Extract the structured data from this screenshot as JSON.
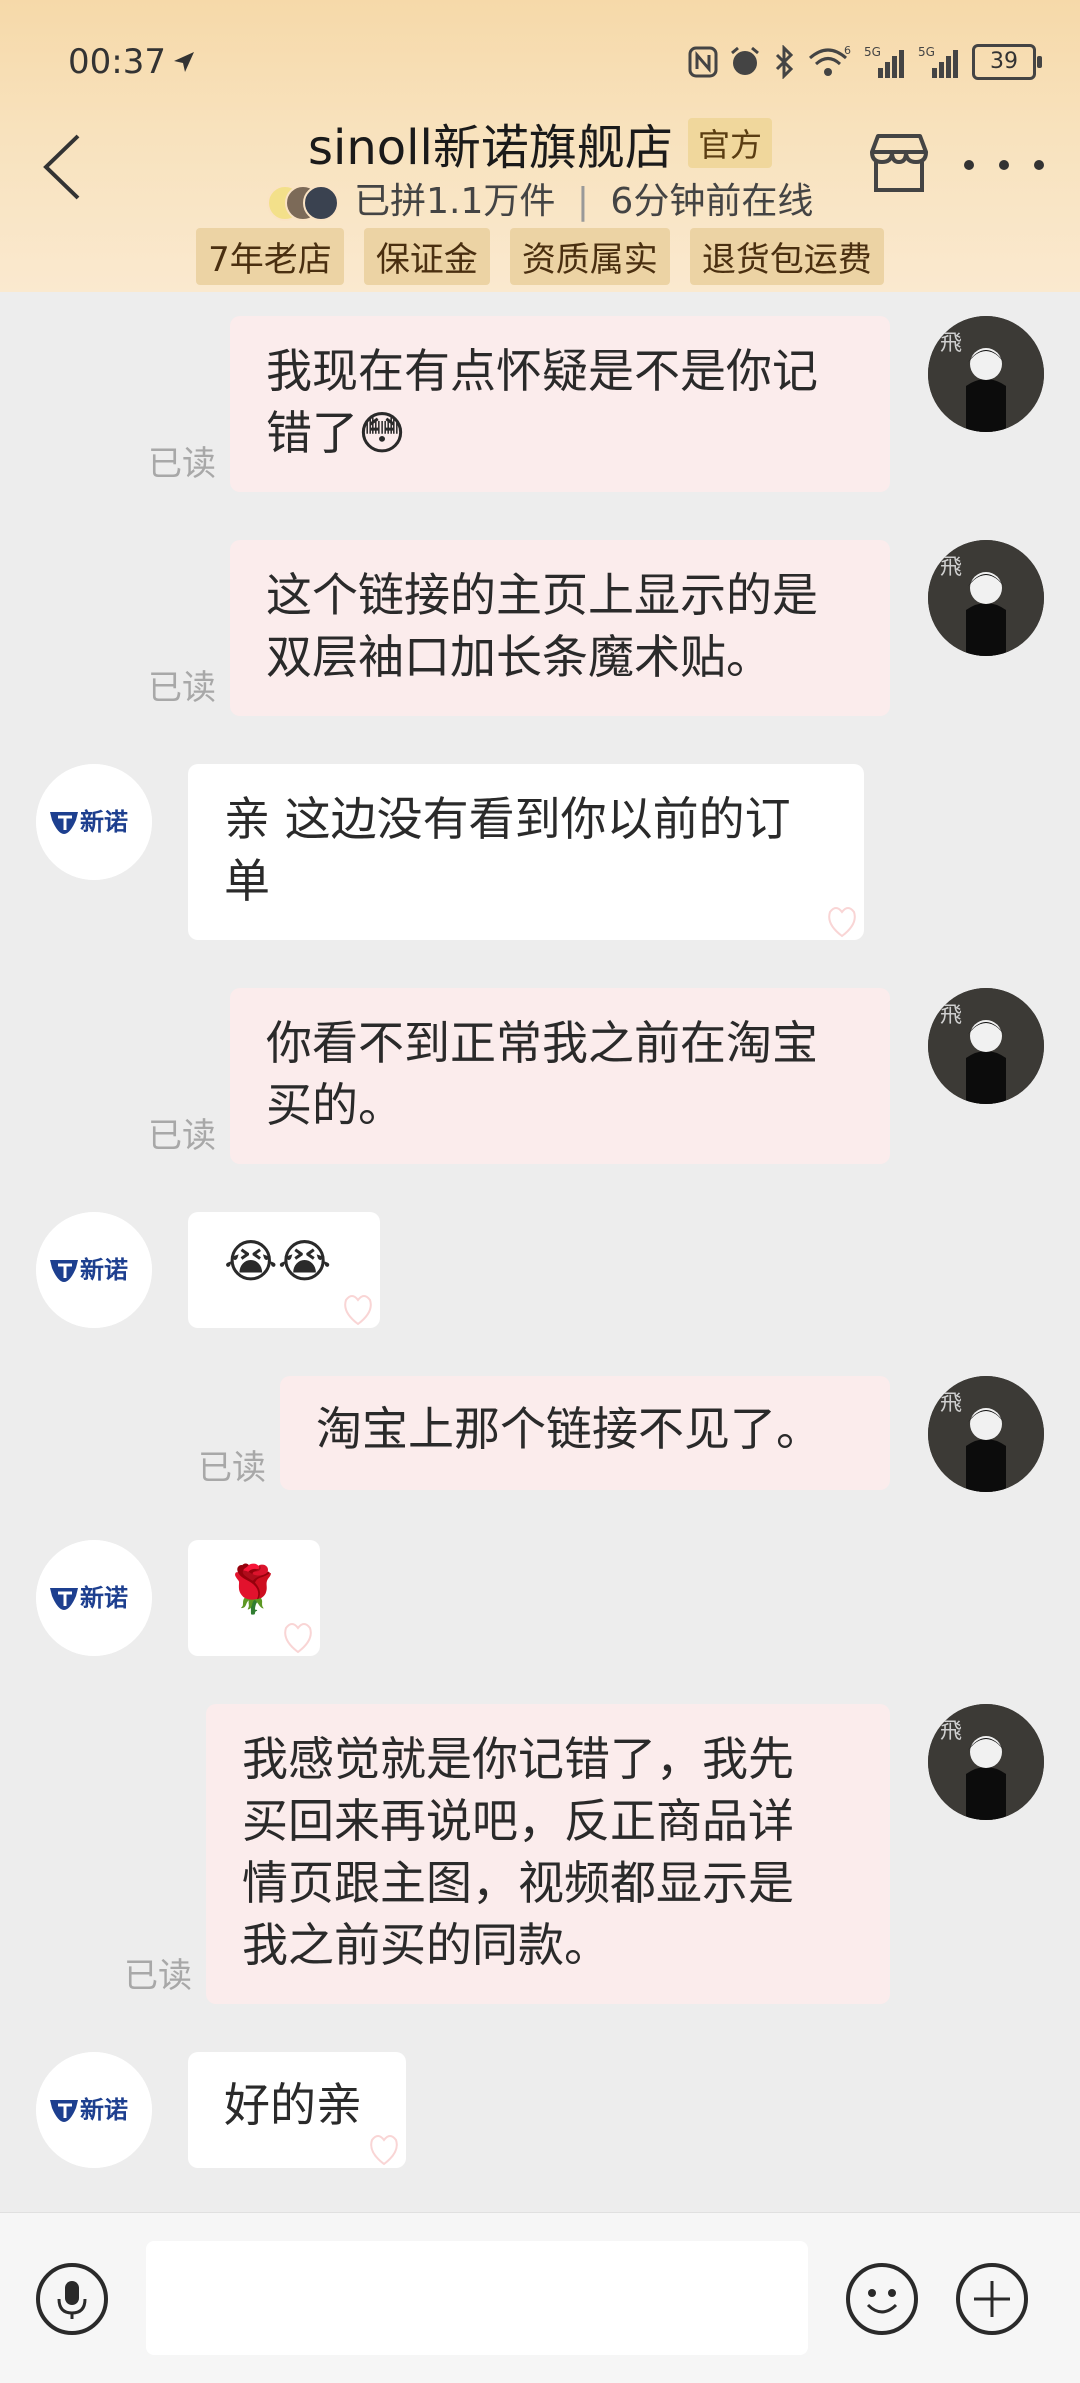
{
  "status_bar": {
    "time": "00:37",
    "battery": "39"
  },
  "header": {
    "shop_name": "sinoll新诺旗舰店",
    "official_badge": "官方",
    "stats": "已拼1.1万件",
    "online": "6分钟前在线",
    "tags": [
      "7年老店",
      "保证金",
      "资质属实",
      "退货包运费"
    ],
    "icons": {
      "back": "chevron-left-icon",
      "shop": "store-icon",
      "more": "more-dots-icon"
    }
  },
  "shop_logo_text": "新诺",
  "user_avatar_char": "飛",
  "read_label": "已读",
  "messages": [
    {
      "from": "me",
      "text_line1": "我现在有点怀疑是不是你记",
      "text_line2": "错了",
      "emoji": "😳"
    },
    {
      "from": "me",
      "text_line1": "这个链接的主页上显示的是",
      "text_line2": "双层袖口加长条魔术贴。"
    },
    {
      "from": "shop",
      "text_line1": "亲 这边没有看到你以前的订",
      "text_line2": "单"
    },
    {
      "from": "me",
      "text_line1": "你看不到正常我之前在淘宝",
      "text_line2": "买的。"
    },
    {
      "from": "shop",
      "emoji": "😭😭"
    },
    {
      "from": "me",
      "text_line1": "淘宝上那个链接不见了。"
    },
    {
      "from": "shop",
      "emoji": "🌹"
    },
    {
      "from": "me",
      "text_line1": "我感觉就是你记错了，我先",
      "text_line2": "买回来再说吧，反正商品详",
      "text_line3": "情页跟主图，视频都显示是",
      "text_line4": "我之前买的同款。"
    },
    {
      "from": "shop",
      "text_line1": "好的亲"
    }
  ],
  "input_bar": {
    "placeholder": "",
    "icons": {
      "voice": "microphone-icon",
      "emoji": "smiley-icon",
      "plus": "plus-icon"
    }
  },
  "colors": {
    "header_bg": "#f8e2bd",
    "outgoing_bubble": "#fbecec",
    "incoming_bubble": "#ffffff",
    "chat_bg": "#ededed",
    "tag_bg": "#ecd3a4"
  }
}
